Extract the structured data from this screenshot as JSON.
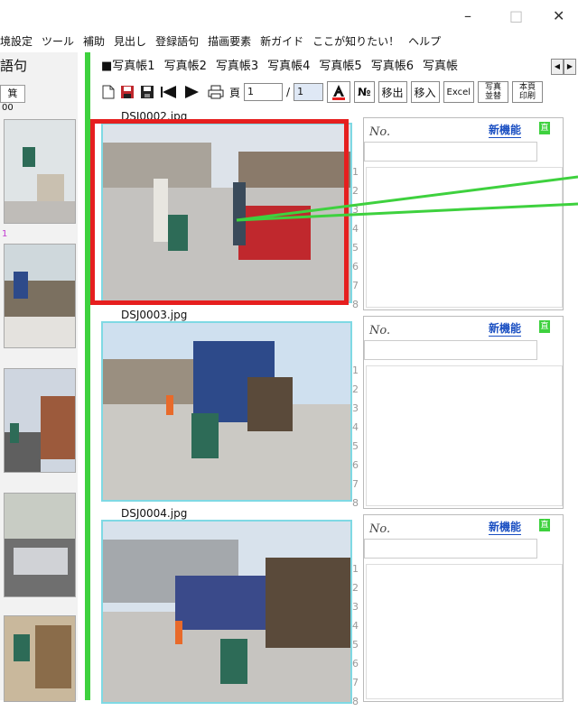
{
  "window": {
    "minimize": "–",
    "maximize": "□",
    "close": "✕"
  },
  "menu": [
    "境設定",
    "ツール",
    "補助",
    "見出し",
    "登録語句",
    "描画要素",
    "新ガイド",
    "ここが知りたい！",
    "ヘルプ"
  ],
  "left_panel": {
    "title": "語句",
    "button": "箕",
    "labels": [
      "00",
      "1"
    ]
  },
  "tabs": [
    "■写真帳1",
    "写真帳2",
    "写真帳3",
    "写真帳4",
    "写真帳5",
    "写真帳6",
    "写真帳"
  ],
  "toolbar": {
    "page_label": "頁",
    "page_value": "1",
    "page_sep": "/",
    "page_total": "1",
    "no_btn": "№",
    "move_out": "移出",
    "move_in": "移入",
    "excel": "Excel",
    "photo_sort": "写真並替",
    "print": "本頁印刷"
  },
  "rows": [
    {
      "file": "DSJ0002.jpg",
      "no_label": "No.",
      "new_feature": "新機能",
      "badge": "直"
    },
    {
      "file": "DSJ0003.jpg",
      "no_label": "No.",
      "new_feature": "新機能",
      "badge": "直"
    },
    {
      "file": "DSJ0004.jpg",
      "no_label": "No.",
      "new_feature": "新機能",
      "badge": "直"
    }
  ],
  "line_numbers": [
    "1",
    "2",
    "3",
    "4",
    "5",
    "6",
    "7",
    "8"
  ],
  "colors": {
    "accent_green": "#3ed13e",
    "highlight_red": "#e61f1f",
    "photo_border": "#7fd9e4",
    "link_blue": "#1a4fc2"
  }
}
